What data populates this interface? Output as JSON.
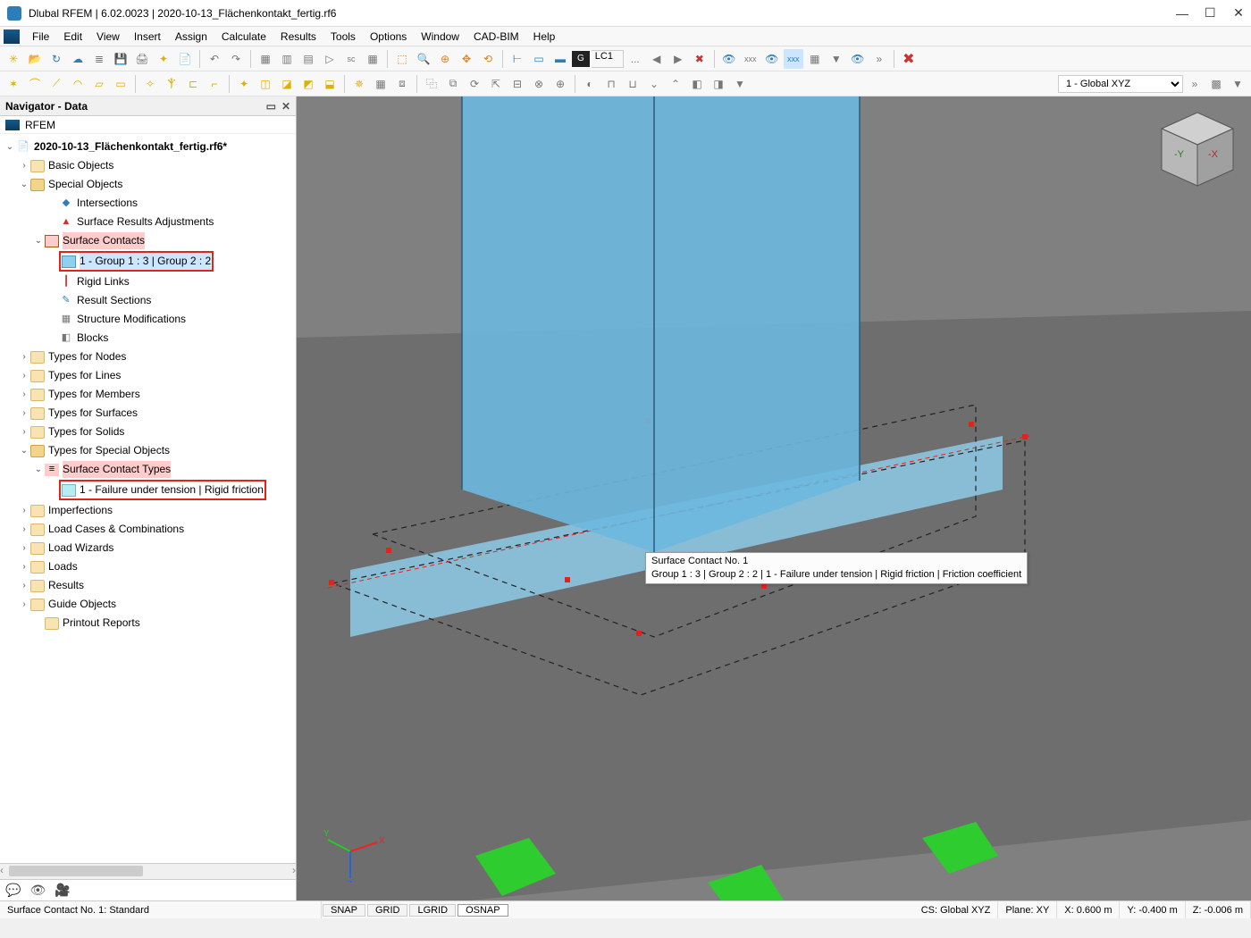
{
  "window": {
    "title": "Dlubal RFEM | 6.02.0023 | 2020-10-13_Flächenkontakt_fertig.rf6"
  },
  "menu": [
    "File",
    "Edit",
    "View",
    "Insert",
    "Assign",
    "Calculate",
    "Results",
    "Tools",
    "Options",
    "Window",
    "CAD-BIM",
    "Help"
  ],
  "loadcase": {
    "g": "G",
    "lc": "LC1",
    "ell": "..."
  },
  "global_dd": "1 - Global XYZ",
  "navigator": {
    "title": "Navigator - Data",
    "root": "RFEM",
    "file": "2020-10-13_Flächenkontakt_fertig.rf6*",
    "basic": "Basic Objects",
    "special": "Special Objects",
    "intersections": "Intersections",
    "sra": "Surface Results Adjustments",
    "surfcont": "Surface Contacts",
    "surfcont_item": "1 - Group 1 : 3 | Group 2 : 2",
    "rigid": "Rigid Links",
    "ressec": "Result Sections",
    "strmod": "Structure Modifications",
    "blocks": "Blocks",
    "t_nodes": "Types for Nodes",
    "t_lines": "Types for Lines",
    "t_members": "Types for Members",
    "t_surfaces": "Types for Surfaces",
    "t_solids": "Types for Solids",
    "t_special": "Types for Special Objects",
    "sct": "Surface Contact Types",
    "sct_item": "1 - Failure under tension | Rigid friction",
    "imperf": "Imperfections",
    "lcc": "Load Cases & Combinations",
    "lwiz": "Load Wizards",
    "loads": "Loads",
    "results": "Results",
    "guide": "Guide Objects",
    "printout": "Printout Reports"
  },
  "tooltip": {
    "l1": "Surface Contact No. 1",
    "l2": "Group 1 : 3 | Group 2 : 2 | 1 - Failure under tension | Rigid friction | Friction coefficient"
  },
  "status": {
    "left": "Surface Contact No. 1: Standard",
    "snap": "SNAP",
    "grid": "GRID",
    "lgrid": "LGRID",
    "osnap": "OSNAP",
    "cs": "CS: Global XYZ",
    "plane": "Plane: XY",
    "x": "X: 0.600 m",
    "y": "Y: -0.400 m",
    "z": "Z: -0.006 m"
  }
}
